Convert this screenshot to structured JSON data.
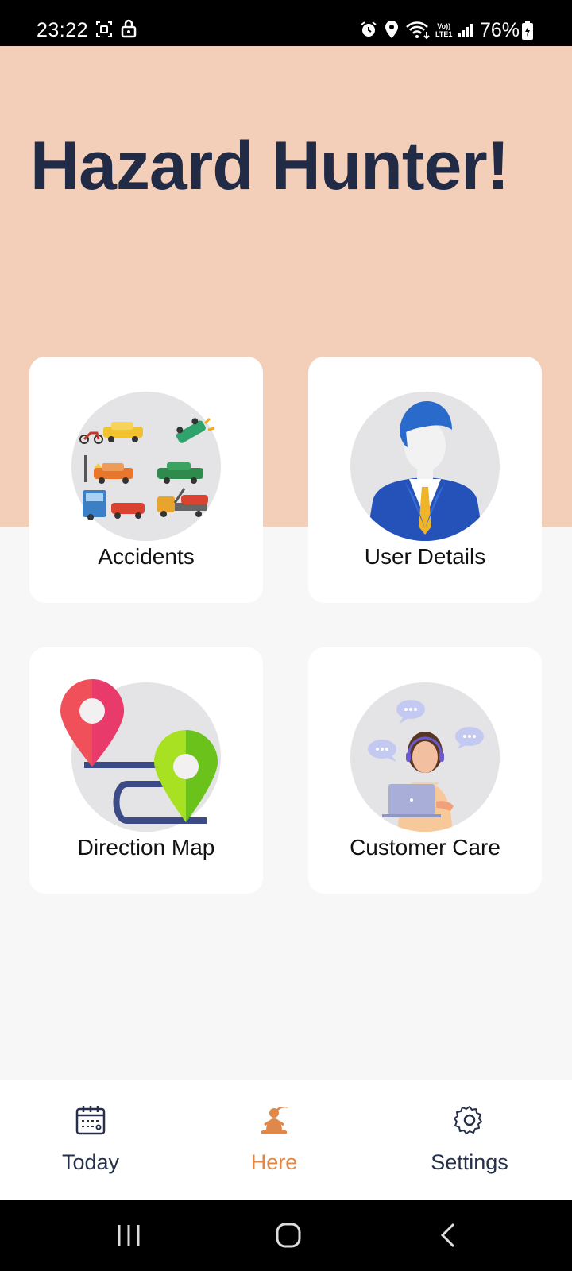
{
  "status_bar": {
    "time": "23:22",
    "battery": "76%",
    "network": "Vo))\nLTE1"
  },
  "app": {
    "title": "Hazard Hunter!"
  },
  "cards": {
    "accidents": "Accidents",
    "user_details": "User Details",
    "direction_map": "Direction Map",
    "customer_care": "Customer Care"
  },
  "bottom_nav": {
    "today": "Today",
    "here": "Here",
    "settings": "Settings",
    "active": "here"
  },
  "colors": {
    "hero_bg": "#f3cfba",
    "title": "#212b46",
    "active_nav": "#e0884a",
    "nav_text": "#26304a"
  }
}
